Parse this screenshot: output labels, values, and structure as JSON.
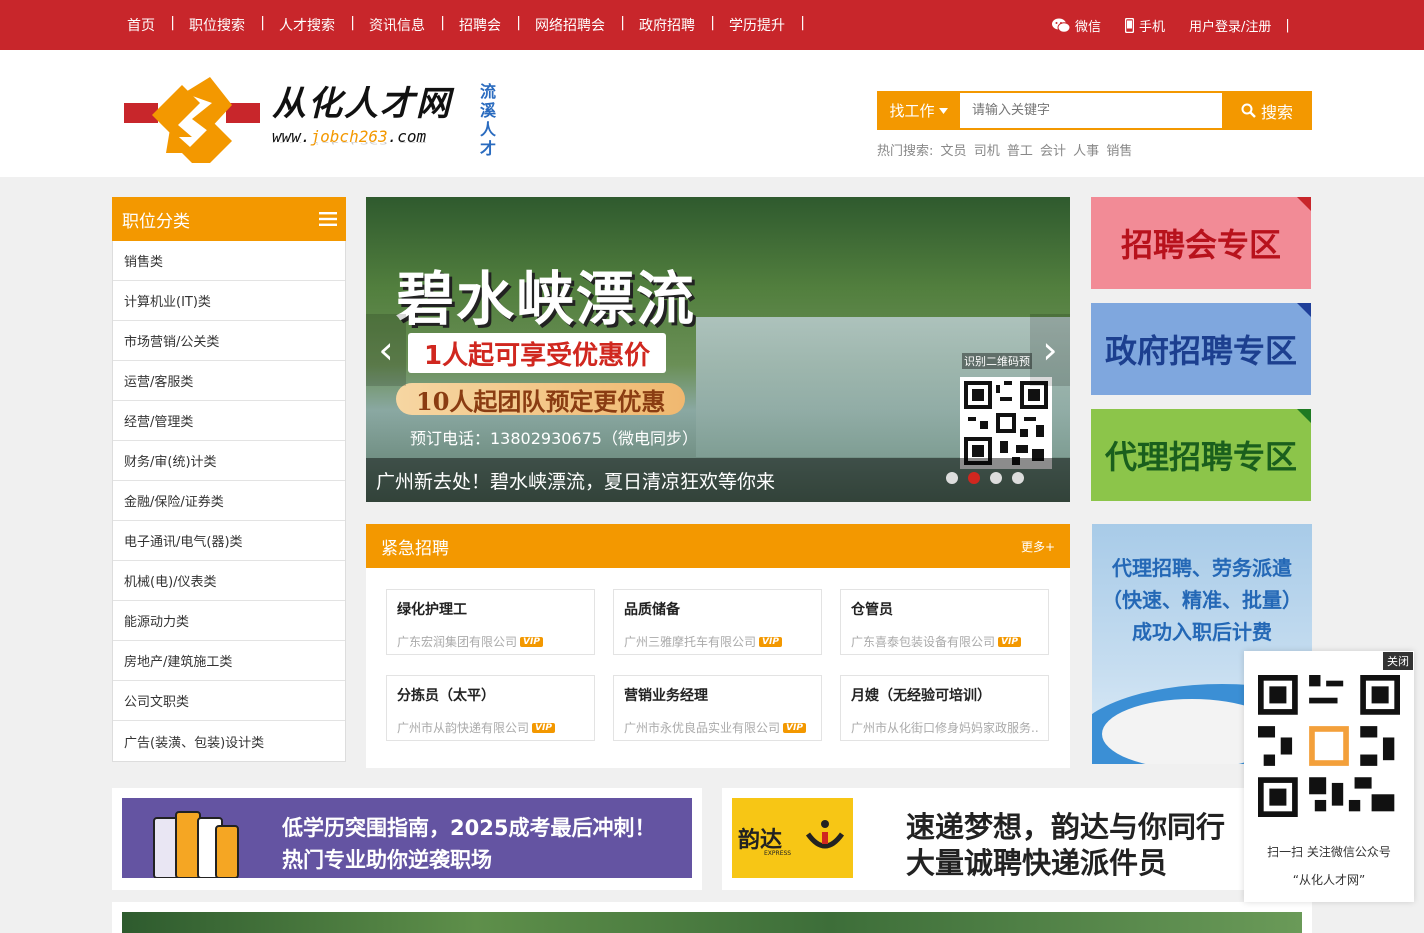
{
  "topnav": {
    "links": [
      "首页",
      "职位搜索",
      "人才搜索",
      "资讯信息",
      "招聘会",
      "网络招聘会",
      "政府招聘",
      "学历提升"
    ],
    "wechat": "微信",
    "mobile": "手机",
    "login": "用户登录/注册",
    "sep": "|"
  },
  "header": {
    "logo_cn": "从化人才网",
    "logo_en_pre": "www.",
    "logo_en_mid": "jobch263",
    "logo_en_post": ".com",
    "logo_en_mirror": "www.jobch263.com",
    "logo_vertical": "流溪人才"
  },
  "search": {
    "type": "找工作",
    "placeholder": "请输入关键字",
    "button": "搜索",
    "hot_label": "热门搜索:",
    "hot_terms": [
      "文员",
      "司机",
      "普工",
      "会计",
      "人事",
      "销售"
    ]
  },
  "categories": {
    "title": "职位分类",
    "items": [
      "销售类",
      "计算机业(IT)类",
      "市场营销/公关类",
      "运营/客服类",
      "经营/管理类",
      "财务/审(统)计类",
      "金融/保险/证券类",
      "电子通讯/电气(器)类",
      "机械(电)/仪表类",
      "能源动力类",
      "房地产/建筑施工类",
      "公司文职类",
      "广告(装潢、包装)设计类"
    ]
  },
  "slider": {
    "title": "碧水峡漂流",
    "tag1": "1人起可享受优惠价",
    "tag2": "10人起团队预定更优惠",
    "phone": "预订电话：13802930675（微电同步）",
    "qr_label": "识别二维码预",
    "caption": "广州新去处！碧水峡漂流，夏日清凉狂欢等你来",
    "prev": "‹",
    "next": "›",
    "dots": 4,
    "active_dot": 1
  },
  "zones": {
    "fair": "招聘会专区",
    "gov": "政府招聘专区",
    "agent": "代理招聘专区"
  },
  "urgent": {
    "title": "紧急招聘",
    "more": "更多+",
    "vip": "VIP",
    "jobs": [
      {
        "title": "绿化护理工",
        "company": "广东宏润集团有限公司",
        "vip": true
      },
      {
        "title": "品质储备",
        "company": "广州三雅摩托车有限公司",
        "vip": true
      },
      {
        "title": "仓管员",
        "company": "广东喜泰包装设备有限公司",
        "vip": true
      },
      {
        "title": "分拣员（太平）",
        "company": "广州市从韵快递有限公司",
        "vip": true
      },
      {
        "title": "营销业务经理",
        "company": "广州市永优良品实业有限公司",
        "vip": true
      },
      {
        "title": "月嫂（无经验可培训）",
        "company": "广州市从化街口修身妈妈家政服务...",
        "vip": false
      }
    ]
  },
  "agent_ad": {
    "line1": "代理招聘、劳务派遣",
    "line2": "（快速、精准、批量）",
    "line3": "成功入职后计费"
  },
  "qr_float": {
    "close": "关闭",
    "caption1": "扫一扫 关注微信公众号",
    "caption2": "“从化人才网”"
  },
  "banners": {
    "edu_line1": "低学历突围指南，2025成考最后冲刺！",
    "edu_line2": "热门专业助你逆袭职场",
    "yunda_logo": "韵达",
    "yunda_express": "EXPRESS",
    "yunda_line1": "速递梦想，韵达与你同行",
    "yunda_line2": "大量诚聘快递派件员"
  },
  "colors": {
    "brand_red": "#c8262b",
    "accent_orange": "#f39800"
  }
}
